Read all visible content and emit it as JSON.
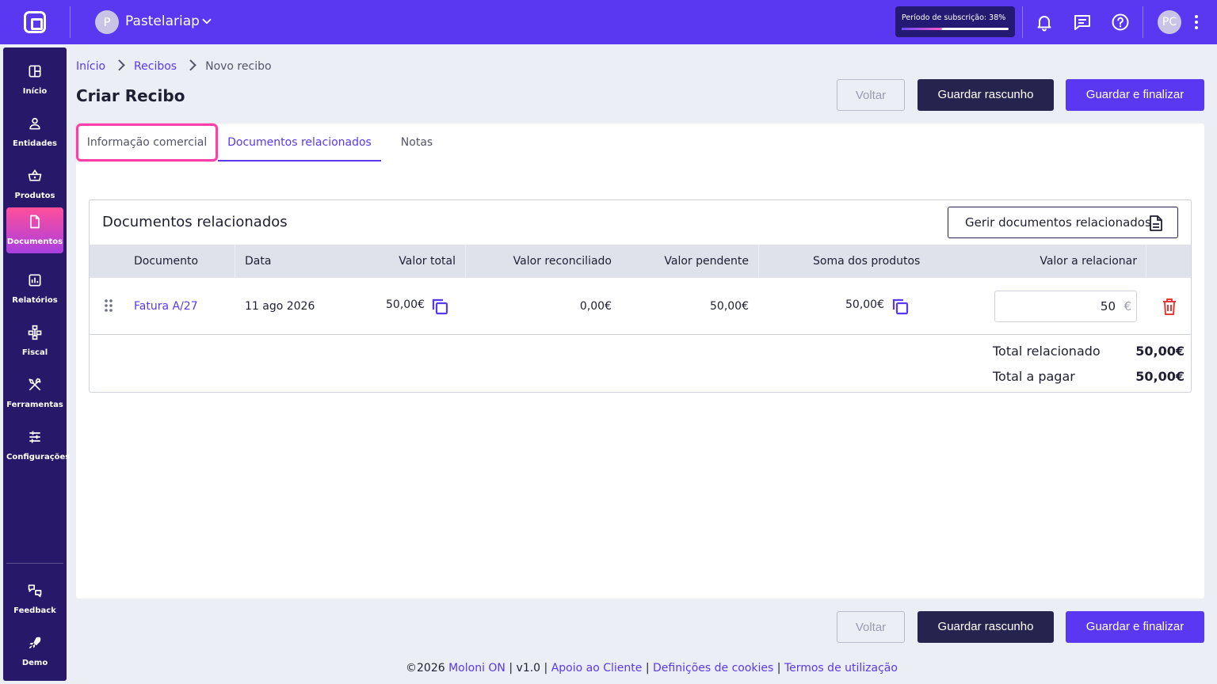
{
  "topbar": {
    "company_initial": "P",
    "company_name": "Pastelariap",
    "subscription_label": "Período de subscrição: 38%",
    "subscription_progress": 0.38,
    "user_initials": "PC"
  },
  "sidebar": {
    "items": [
      {
        "label": "Início",
        "icon": "dashboard-icon"
      },
      {
        "label": "Entidades",
        "icon": "user-icon"
      },
      {
        "label": "Produtos",
        "icon": "basket-icon"
      },
      {
        "label": "Documentos",
        "icon": "document-icon",
        "active": true
      },
      {
        "label": "Relatórios",
        "icon": "chart-icon"
      },
      {
        "label": "Fiscal",
        "icon": "hierarchy-icon"
      },
      {
        "label": "Ferramentas",
        "icon": "tools-icon"
      },
      {
        "label": "Configurações",
        "icon": "sliders-icon"
      }
    ],
    "bottom": [
      {
        "label": "Feedback",
        "icon": "feedback-icon"
      },
      {
        "label": "Demo",
        "icon": "rocket-icon"
      }
    ]
  },
  "breadcrumb": {
    "home": "Início",
    "section": "Recibos",
    "current": "Novo recibo"
  },
  "page_title": "Criar Recibo",
  "actions": {
    "back": "Voltar",
    "draft": "Guardar rascunho",
    "finalize": "Guardar e finalizar"
  },
  "tabs": [
    "Informação comercial",
    "Documentos relacionados",
    "Notas"
  ],
  "related": {
    "title": "Documentos relacionados",
    "manage_button": "Gerir documentos relacionados",
    "columns": [
      "Documento",
      "Data",
      "Valor total",
      "Valor reconciliado",
      "Valor pendente",
      "Soma dos produtos",
      "Valor a relacionar"
    ],
    "rows": [
      {
        "document": "Fatura A/27",
        "date": "11 ago 2026",
        "total": "50,00€",
        "reconciled": "0,00€",
        "pending": "50,00€",
        "products_sum": "50,00€",
        "relate_value": "50",
        "relate_unit": "€"
      }
    ],
    "totals": [
      {
        "label": "Total relacionado",
        "value": "50,00€"
      },
      {
        "label": "Total a pagar",
        "value": "50,00€"
      }
    ]
  },
  "footer": {
    "copyright": "©2026",
    "brand": "Moloni ON",
    "version": "v1.0",
    "support": "Apoio ao Cliente",
    "cookies": "Definições de cookies",
    "terms": "Termos de utilização",
    "sep": "|"
  },
  "colors": {
    "brand": "#5a37f0",
    "sidebar": "#27186a",
    "draft_button": "#27234f",
    "highlight": "#ff3fa6",
    "delete": "#e53935"
  }
}
